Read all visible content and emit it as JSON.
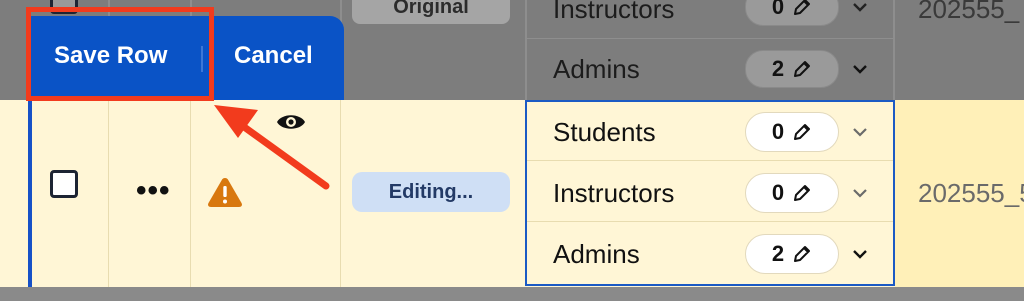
{
  "toolbar": {
    "save_label": "Save Row",
    "cancel_label": "Cancel"
  },
  "dimmed_row_above": {
    "status": "Original",
    "roles": [
      {
        "label": "Instructors",
        "count": "0"
      },
      {
        "label": "Admins",
        "count": "2"
      }
    ],
    "id": "202555_"
  },
  "edited_row": {
    "status": "Editing...",
    "roles": [
      {
        "label": "Students",
        "count": "0"
      },
      {
        "label": "Instructors",
        "count": "0"
      },
      {
        "label": "Admins",
        "count": "2"
      }
    ],
    "id": "202555_5"
  },
  "icons": [
    "eye-icon",
    "warning-icon",
    "pencil-icon",
    "chevron-down-icon",
    "more-icon"
  ],
  "colors": {
    "toolbar_blue": "#0a53c6",
    "highlight_red": "#f23b1d",
    "editing_row_bg": "#fff6d6",
    "warning_orange": "#d8780f"
  }
}
